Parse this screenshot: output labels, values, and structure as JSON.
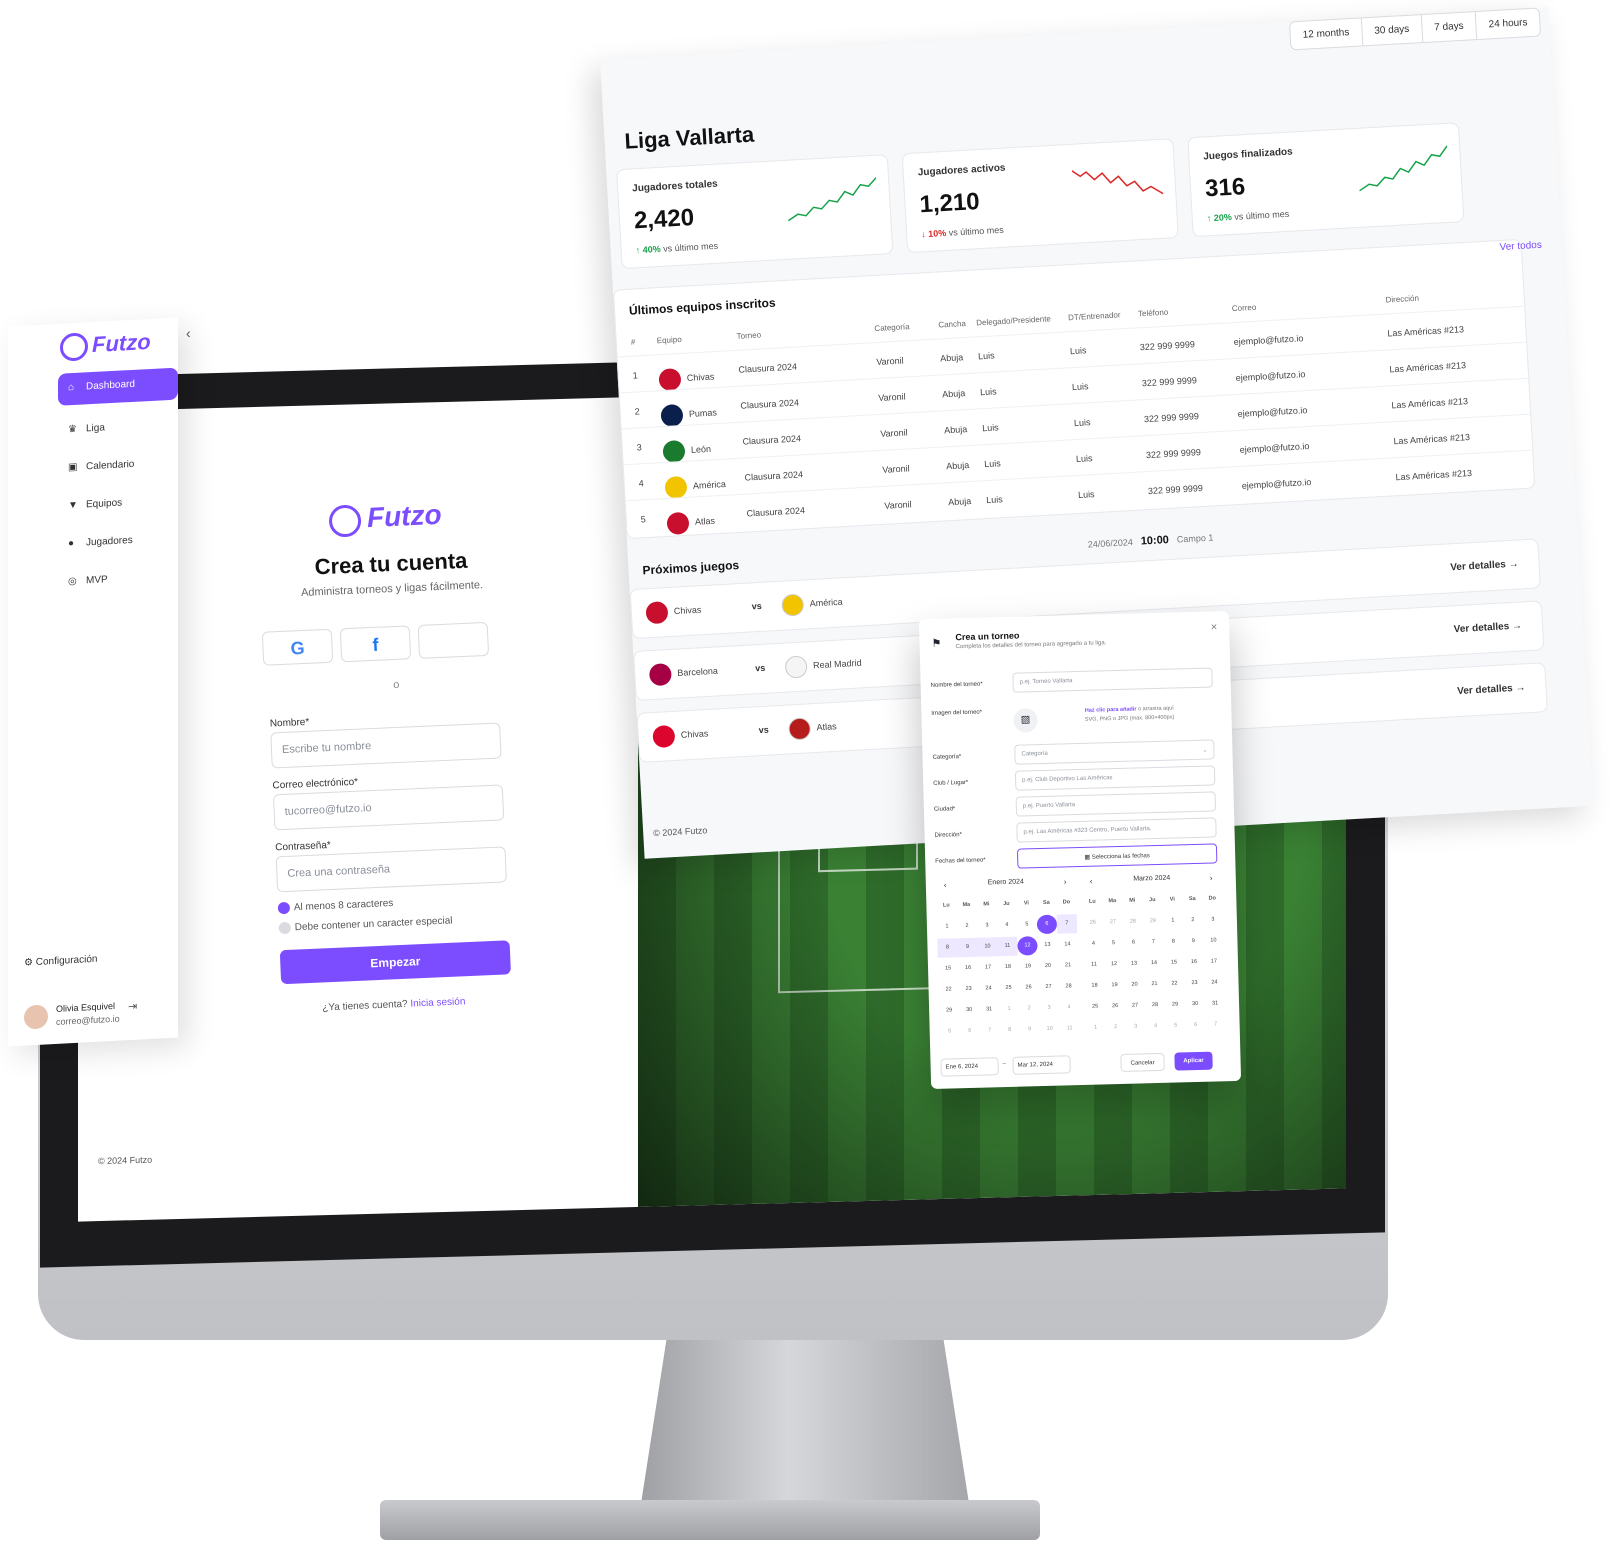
{
  "signup": {
    "logo": "Futzo",
    "title": "Crea tu cuenta",
    "subtitle": "Administra torneos y ligas fácilmente.",
    "social": [
      "G",
      "f",
      ""
    ],
    "divider": "o",
    "name_label": "Nombre*",
    "name_placeholder": "Escribe tu nombre",
    "email_label": "Correo electrónico*",
    "email_placeholder": "tucorreo@futzo.io",
    "password_label": "Contraseña*",
    "password_placeholder": "Crea una contraseña",
    "check1": "Al menos 8 caracteres",
    "check2": "Debe contener un caracter especial",
    "submit": "Empezar",
    "have_account": "¿Ya tienes cuenta?",
    "login_link": "Inicia sesión",
    "copyright": "© 2024 Futzo"
  },
  "sidebar": {
    "logo": "Futzo",
    "collapse": "‹",
    "items": [
      {
        "label": "Dashboard",
        "icon": "home-icon"
      },
      {
        "label": "Liga",
        "icon": "trophy-icon"
      },
      {
        "label": "Calendario",
        "icon": "calendar-icon"
      },
      {
        "label": "Equipos",
        "icon": "shirt-icon"
      },
      {
        "label": "Jugadores",
        "icon": "users-icon"
      },
      {
        "label": "MVP",
        "icon": "ball-icon"
      }
    ],
    "config": "Configuración",
    "user": {
      "name": "Olivia Esquivel",
      "email": "correo@futzo.io"
    }
  },
  "dashboard": {
    "time_ranges": [
      "12 months",
      "30 days",
      "7 days",
      "24 hours"
    ],
    "title": "Liga Vallarta",
    "kpis": [
      {
        "label": "Jugadores totales",
        "value": "2,420",
        "delta": "40%",
        "trend": "up",
        "note": "vs último mes"
      },
      {
        "label": "Jugadores activos",
        "value": "1,210",
        "delta": "10%",
        "trend": "down",
        "note": "vs último mes"
      },
      {
        "label": "Juegos finalizados",
        "value": "316",
        "delta": "20%",
        "trend": "up",
        "note": "vs último mes"
      }
    ],
    "table": {
      "title": "Últimos equipos inscritos",
      "columns": [
        "#",
        "Equipo",
        "Torneo",
        "Categoría",
        "Cancha",
        "Delegado/Presidente",
        "DT/Entrenador",
        "Teléfono",
        "Correo",
        "Dirección"
      ],
      "rows": [
        [
          "1",
          "Chivas",
          "Clausura 2024",
          "Varonil",
          "Abuja",
          "Luis",
          "Luis",
          "322 999 9999",
          "ejemplo@futzo.io",
          "Las Américas #213"
        ],
        [
          "2",
          "Pumas",
          "Clausura 2024",
          "Varonil",
          "Abuja",
          "Luis",
          "Luis",
          "322 999 9999",
          "ejemplo@futzo.io",
          "Las Américas #213"
        ],
        [
          "3",
          "León",
          "Clausura 2024",
          "Varonil",
          "Abuja",
          "Luis",
          "Luis",
          "322 999 9999",
          "ejemplo@futzo.io",
          "Las Américas #213"
        ],
        [
          "4",
          "América",
          "Clausura 2024",
          "Varonil",
          "Abuja",
          "Luis",
          "Luis",
          "322 999 9999",
          "ejemplo@futzo.io",
          "Las Américas #213"
        ],
        [
          "5",
          "Atlas",
          "Clausura 2024",
          "Varonil",
          "Abuja",
          "Luis",
          "Luis",
          "322 999 9999",
          "ejemplo@futzo.io",
          "Las Américas #213"
        ]
      ],
      "crest_colors": [
        "#c8102e",
        "#0b1f4d",
        "#1a7a2e",
        "#f2c400",
        "#c8102e"
      ],
      "view_all": "Ver todos"
    },
    "games": {
      "title": "Próximos juegos",
      "date": "24/06/2024",
      "time": "10:00",
      "field": "Campo 1",
      "items": [
        {
          "home": "Chivas",
          "away": "América"
        },
        {
          "home": "Barcelona",
          "away": "Real Madrid"
        },
        {
          "home": "Chivas",
          "away": "Atlas"
        }
      ],
      "vs": "vs",
      "details": "Ver detalles"
    },
    "footer": "© 2024 Futzo"
  },
  "modal": {
    "title": "Crea un torneo",
    "subtitle": "Completa los detalles del torneo para agregarlo a tu liga.",
    "close": "×",
    "fields": [
      {
        "label": "Nombre del torneo*",
        "placeholder": "p.ej. Torneo Vallarta"
      },
      {
        "label": "Categoría*",
        "placeholder": "Categoría"
      },
      {
        "label": "Club / Lugar*",
        "placeholder": "p.ej. Club Deportivo Las Américas"
      },
      {
        "label": "Ciudad*",
        "placeholder": "p.ej. Puerto Vallarta"
      },
      {
        "label": "Dirección*",
        "placeholder": "p.ej. Las Américas #323 Centro, Puerto Vallarta."
      }
    ],
    "image_label": "Imagen del torneo*",
    "upload_link": "Haz clic para añadir",
    "upload_text": "o arrastra aquí",
    "upload_hint": "SVG, PNG o JPG (max. 800×400px)",
    "dates_label": "Fechas del torneo*",
    "dates_button": "Selecciona las fechas",
    "calendars": [
      {
        "month": "Enero 2024"
      },
      {
        "month": "Marzo 2024"
      }
    ],
    "weekdays": [
      "Lu",
      "Ma",
      "Mi",
      "Ju",
      "Vi",
      "Sa",
      "Do"
    ],
    "start_date": "Ene 6, 2024",
    "end_date": "Mar 12, 2024",
    "range_sep": "–",
    "cancel": "Cancelar",
    "apply": "Aplicar"
  }
}
